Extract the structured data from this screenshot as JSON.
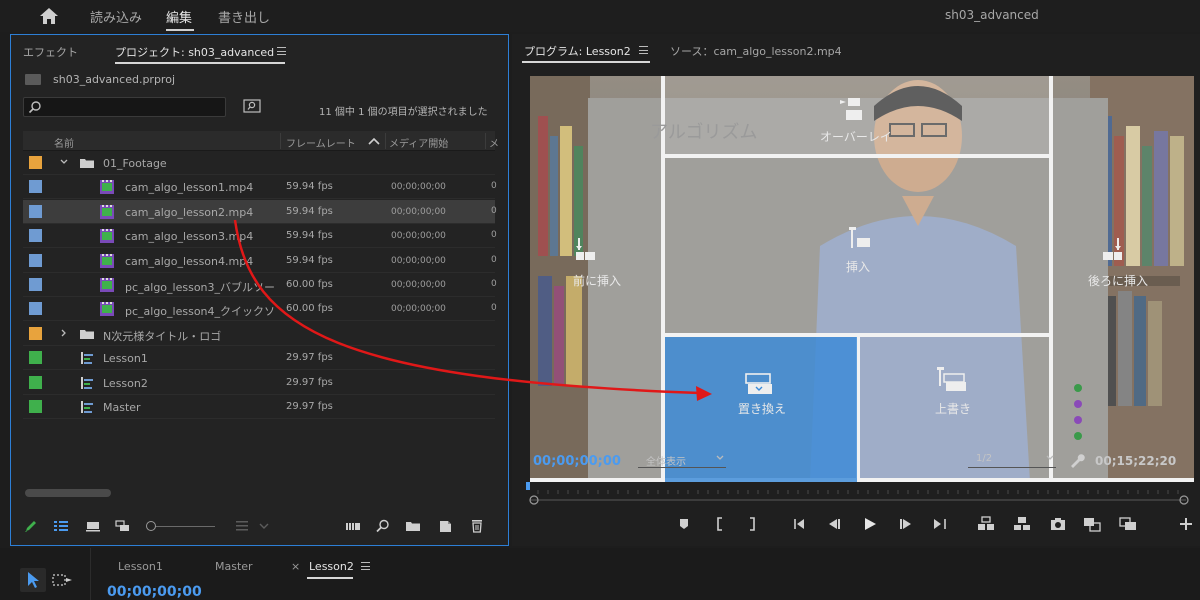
{
  "topbar": {
    "home_icon": "home-icon",
    "menu": [
      "読み込み",
      "編集",
      "書き出し"
    ],
    "active_menu": "編集",
    "project_title": "sh03_advanced"
  },
  "project_panel": {
    "tabs": [
      "エフェクト",
      "プロジェクト: sh03_advanced"
    ],
    "active_tab": "プロジェクト: sh03_advanced",
    "project_file": "sh03_advanced.prproj",
    "search_placeholder": "",
    "selection_status": "11 個中 1 個の項目が選択されました",
    "columns": [
      "名前",
      "フレームレート",
      "メディア開始",
      "メ"
    ],
    "rows": [
      {
        "type": "bin",
        "name": "01_Footage",
        "color": "#e8a33d",
        "fps": "",
        "start": "",
        "expanded": true,
        "indent": 0
      },
      {
        "type": "clip",
        "name": "cam_algo_lesson1.mp4",
        "color": "#6f9bd2",
        "fps": "59.94 fps",
        "start": "00;00;00;00",
        "indent": 1
      },
      {
        "type": "clip",
        "name": "cam_algo_lesson2.mp4",
        "color": "#6f9bd2",
        "fps": "59.94 fps",
        "start": "00;00;00;00",
        "indent": 1,
        "selected": true
      },
      {
        "type": "clip",
        "name": "cam_algo_lesson3.mp4",
        "color": "#6f9bd2",
        "fps": "59.94 fps",
        "start": "00;00;00;00",
        "indent": 1
      },
      {
        "type": "clip",
        "name": "cam_algo_lesson4.mp4",
        "color": "#6f9bd2",
        "fps": "59.94 fps",
        "start": "00;00;00;00",
        "indent": 1
      },
      {
        "type": "clip",
        "name": "pc_algo_lesson3_バブルソー",
        "color": "#6f9bd2",
        "fps": "60.00 fps",
        "start": "00;00;00;00",
        "indent": 1
      },
      {
        "type": "clip",
        "name": "pc_algo_lesson4_クイックソ",
        "color": "#6f9bd2",
        "fps": "60.00 fps",
        "start": "00;00;00;00",
        "indent": 1
      },
      {
        "type": "bin",
        "name": "N次元様タイトル・ロゴ",
        "color": "#e8a33d",
        "fps": "",
        "start": "",
        "expanded": false,
        "indent": 0
      },
      {
        "type": "sequence",
        "name": "Lesson1",
        "color": "#3fb04c",
        "fps": "29.97 fps",
        "start": "",
        "indent": 0
      },
      {
        "type": "sequence",
        "name": "Lesson2",
        "color": "#3fb04c",
        "fps": "29.97 fps",
        "start": "",
        "indent": 0
      },
      {
        "type": "sequence",
        "name": "Master",
        "color": "#3fb04c",
        "fps": "29.97 fps",
        "start": "",
        "indent": 0
      }
    ]
  },
  "program_monitor": {
    "tabs": [
      "プログラム: Lesson2",
      "ソース：cam_algo_lesson2.mp4"
    ],
    "active_tab": "プログラム: Lesson2",
    "overlay_labels": {
      "overlay": "オーバーレイ",
      "insert_before": "前に挿入",
      "insert": "挿入",
      "insert_after": "後ろに挿入",
      "replace": "置き換え",
      "overwrite": "上書き"
    },
    "whiteboard_text": "アルゴリズム",
    "current_timecode": "00;00;00;00",
    "fit_dropdown": "全体表示",
    "resolution_dropdown": "1/2",
    "duration_timecode": "00;15;22;20",
    "accent_color": "#4b9bf0",
    "replace_highlight_color": "#3a8ad8"
  },
  "timeline": {
    "tabs": [
      "Lesson1",
      "Master",
      "Lesson2"
    ],
    "active_tab": "Lesson2",
    "close_glyph": "×",
    "timecode": "00;00;00;00"
  }
}
